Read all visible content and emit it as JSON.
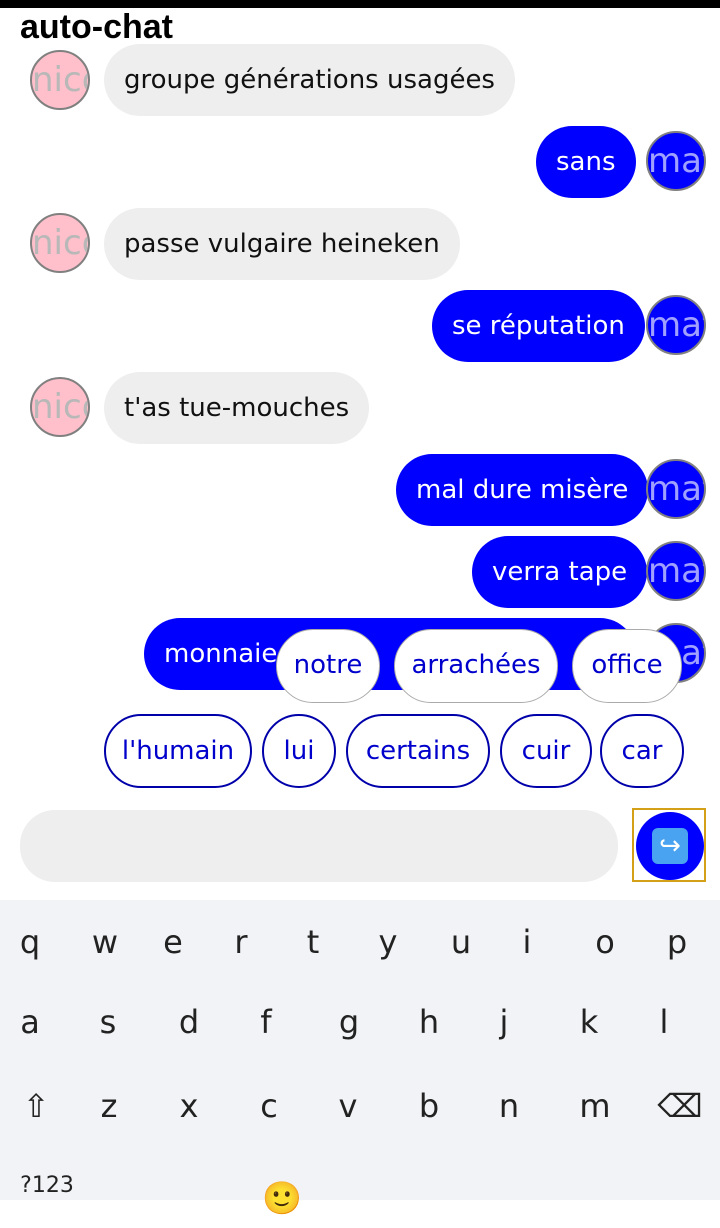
{
  "app": {
    "title": "auto-chat"
  },
  "avatars": {
    "nico": "nico",
    "mat": "mat"
  },
  "messages": [
    {
      "side": "left",
      "text": "groupe générations usagées"
    },
    {
      "side": "right",
      "text": "sans"
    },
    {
      "side": "left",
      "text": "passe vulgaire heineken"
    },
    {
      "side": "right",
      "text": "se réputation"
    },
    {
      "side": "left",
      "text": "t'as tue-mouches"
    },
    {
      "side": "right",
      "text": "mal dure misère"
    },
    {
      "side": "right",
      "text": "verra tape"
    },
    {
      "side": "right",
      "text": "monnaie",
      "partial": true
    }
  ],
  "floating_suggestions": [
    "notre",
    "arrachées",
    "office"
  ],
  "suggestions": [
    "l'humain",
    "lui",
    "certains",
    "cuir",
    "car"
  ],
  "compose": {
    "value": "",
    "placeholder": ""
  },
  "send": {
    "icon": "right-arrow-curving-left-icon",
    "glyph": "↪"
  },
  "keyboard": {
    "row1": [
      "q",
      "w",
      "e",
      "r",
      "t",
      "y",
      "u",
      "i",
      "o",
      "p"
    ],
    "row2": [
      "a",
      "s",
      "d",
      "f",
      "g",
      "h",
      "j",
      "k",
      "l"
    ],
    "row3": [
      "z",
      "x",
      "c",
      "v",
      "b",
      "n",
      "m"
    ],
    "symbols_label": "?123",
    "shift_glyph": "⇧",
    "backspace_glyph": "⌫",
    "emoji_glyph": "🙂"
  },
  "colors": {
    "accent": "#0000ff",
    "nico_avatar": "#ffc0cb",
    "incoming_bubble": "#eeeeee"
  }
}
